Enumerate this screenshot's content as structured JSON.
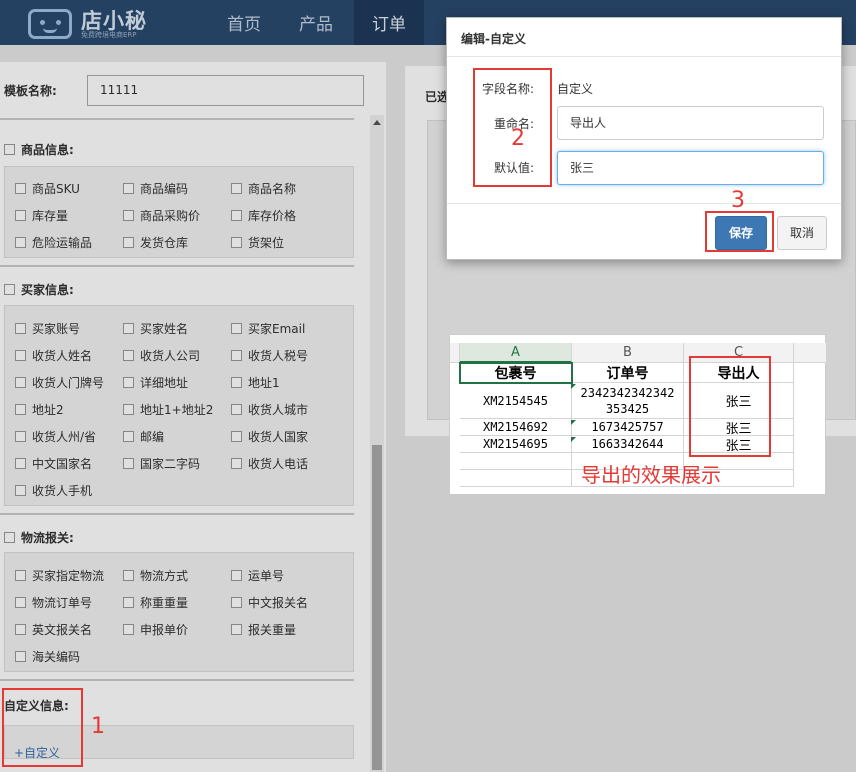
{
  "nav": {
    "logo_text": "店小秘",
    "logo_sub": "免费跨境电商ERP",
    "items": [
      {
        "label": "首页",
        "active": false
      },
      {
        "label": "产品",
        "active": false
      },
      {
        "label": "订单",
        "active": true
      }
    ]
  },
  "template": {
    "label": "模板名称:",
    "value": "11111"
  },
  "sections": {
    "product": {
      "title": "商品信息:",
      "items": [
        "商品SKU",
        "商品编码",
        "商品名称",
        "库存量",
        "商品采购价",
        "库存价格",
        "危险运输品",
        "发货仓库",
        "货架位"
      ]
    },
    "buyer": {
      "title": "买家信息:",
      "items": [
        "买家账号",
        "买家姓名",
        "买家Email",
        "收货人姓名",
        "收货人公司",
        "收货人税号",
        "收货人门牌号",
        "详细地址",
        "地址1",
        "地址2",
        "地址1+地址2",
        "收货人城市",
        "收货人州/省",
        "邮编",
        "收货人国家",
        "中文国家名",
        "国家二字码",
        "收货人电话",
        "收货人手机"
      ]
    },
    "logistics": {
      "title": "物流报关:",
      "items": [
        "买家指定物流",
        "物流方式",
        "运单号",
        "物流订单号",
        "称重重量",
        "中文报关名",
        "英文报关名",
        "申报单价",
        "报关重量",
        "海关编码"
      ]
    },
    "custom": {
      "title": "自定义信息:",
      "add_label": "+自定义"
    }
  },
  "right_panel": {
    "label": "已选"
  },
  "modal": {
    "title": "编辑-自定义",
    "field_name_label": "字段名称:",
    "field_name_value": "自定义",
    "rename_label": "重命名:",
    "rename_value": "导出人",
    "default_label": "默认值:",
    "default_value": "张三",
    "save_label": "保存",
    "cancel_label": "取消"
  },
  "annotations": {
    "one": "1",
    "two": "2",
    "three": "3",
    "color": "#e53935"
  },
  "spreadsheet": {
    "columns": [
      "A",
      "B",
      "C"
    ],
    "headers": [
      "包裹号",
      "订单号",
      "导出人"
    ],
    "rows": [
      {
        "a": "XM2154545",
        "b": "2342342342342 353425",
        "c": "张三"
      },
      {
        "a": "XM2154692",
        "b": "1673425757",
        "c": "张三"
      },
      {
        "a": "XM2154695",
        "b": "1663342644",
        "c": "张三"
      }
    ],
    "caption": "导出的效果展示"
  },
  "colors": {
    "nav_bg": "#2b4a70",
    "primary": "#3d78b4",
    "excel_green": "#217346"
  }
}
